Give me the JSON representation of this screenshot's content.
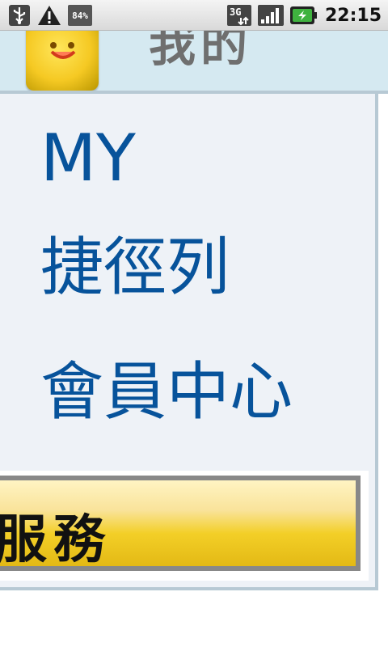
{
  "status_bar": {
    "battery_level_label": "84%",
    "network_type": "3G",
    "time": "22:15",
    "icons": [
      "usb-icon",
      "warning-icon",
      "battery-level-icon",
      "3g-data-icon",
      "signal-strength-icon",
      "battery-charging-icon"
    ]
  },
  "header": {
    "title": "我的",
    "avatar": "emoticon-face"
  },
  "menu": {
    "items": [
      {
        "label": "MY"
      },
      {
        "label": "捷徑列"
      },
      {
        "label": "會員中心"
      }
    ]
  },
  "service": {
    "label": "服務"
  },
  "colors": {
    "menu_text": "#07539b",
    "header_bg": "#d5e9f1",
    "panel_bg": "#eef2f7",
    "service_gold": "#f3cf27"
  }
}
